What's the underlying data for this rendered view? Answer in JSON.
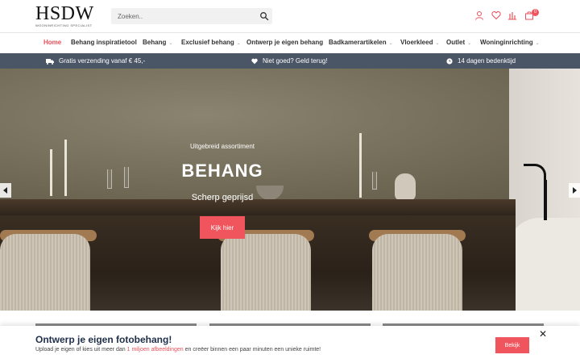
{
  "brand": {
    "logo": "HSDW",
    "tagline": "WOONINRICHTING SPECIALIST",
    "accent_color": "#f0545c",
    "nav_bg": "#4a5565"
  },
  "search": {
    "placeholder": "Zoeken.."
  },
  "header_icons": [
    "user-icon",
    "heart-icon",
    "compare-icon",
    "cart-icon"
  ],
  "cart_count": "0",
  "nav": {
    "items": [
      {
        "label": "Home",
        "active": true
      },
      {
        "label": "Behang inspiratietool"
      },
      {
        "label": "Behang",
        "dropdown": true
      },
      {
        "label": "Exclusief behang",
        "dropdown": true
      },
      {
        "label": "Ontwerp je eigen behang"
      },
      {
        "label": "Badkamerartikelen",
        "dropdown": true
      },
      {
        "label": "Vloerkleed",
        "dropdown": true
      },
      {
        "label": "Outlet",
        "dropdown": true
      },
      {
        "label": "Woninginrichting",
        "dropdown": true
      }
    ]
  },
  "usp": {
    "items": [
      {
        "icon": "truck-icon",
        "text": "Gratis verzending vanaf € 45,-"
      },
      {
        "icon": "heart-icon",
        "text": "Niet goed? Geld terug!"
      },
      {
        "icon": "clock-icon",
        "text": "14 dagen bedenktijd"
      }
    ]
  },
  "hero": {
    "kicker": "Uitgebreid assortiment",
    "title": "BEHANG",
    "subtitle": "Scherp geprijsd",
    "button": "Kijk hier"
  },
  "banner": {
    "title": "Ontwerp je eigen fotobehang!",
    "text_before": "Upload je eigen of kies uit meer dan ",
    "text_highlight": "1 miljoen afbeeldingen",
    "text_after": " en creëer binnen een paar minuten een unieke ruimte!",
    "button": "Bekijk",
    "close": "✕"
  }
}
